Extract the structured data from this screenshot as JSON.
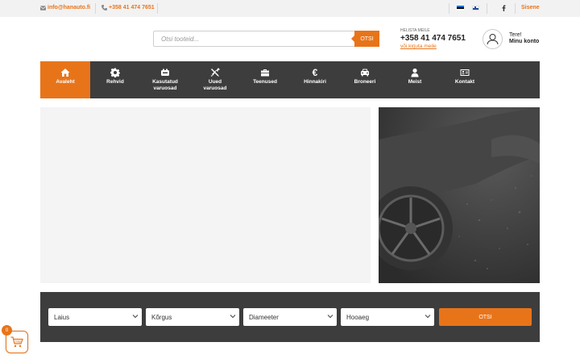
{
  "topbar": {
    "email": "info@hanauto.fi",
    "phone": "+358 41 474 7651",
    "login": "Sisene"
  },
  "header": {
    "search_placeholder": "Otsi tooteid...",
    "search_button": "OTSI",
    "contact_small": "HELISTA MEILE",
    "contact_phone": "+358 41 474 7651",
    "contact_link": "või kirjuta meile",
    "account_hello": "Tere!",
    "account_label": "Minu konto"
  },
  "nav": {
    "items": [
      {
        "label": "Avaleht",
        "icon": "home-icon"
      },
      {
        "label": "Rehvid",
        "icon": "gear-icon"
      },
      {
        "label": "Kasutatud\nvaruosad",
        "icon": "engine-icon"
      },
      {
        "label": "Uued\nvaruosad",
        "icon": "tools-icon"
      },
      {
        "label": "Teenused",
        "icon": "toolbox-icon"
      },
      {
        "label": "Hinnakiri",
        "icon": "euro-icon"
      },
      {
        "label": "Broneeri",
        "icon": "car-icon"
      },
      {
        "label": "Meist",
        "icon": "user-icon"
      },
      {
        "label": "Kontakt",
        "icon": "contact-card-icon"
      }
    ]
  },
  "filter": {
    "selects": [
      "Laius",
      "Kõrgus",
      "Diameeter",
      "Hooaeg"
    ],
    "button": "OTSI"
  },
  "cart": {
    "count": "0"
  },
  "colors": {
    "accent": "#e8741a",
    "nav_bg": "#3d3d3d",
    "topbar_bg": "#f2f2f2"
  }
}
